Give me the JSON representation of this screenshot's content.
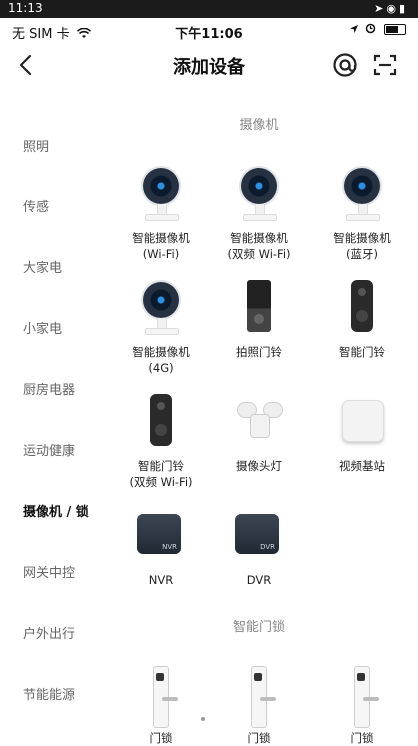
{
  "system_bar": {
    "time": "11:13"
  },
  "ios_status": {
    "carrier": "无 SIM 卡",
    "time": "下午11:06"
  },
  "navbar": {
    "title": "添加设备"
  },
  "sidebar": {
    "items": [
      {
        "label": "照明"
      },
      {
        "label": "传感"
      },
      {
        "label": "大家电"
      },
      {
        "label": "小家电"
      },
      {
        "label": "厨房电器"
      },
      {
        "label": "运动健康"
      },
      {
        "label": "摄像机 / 锁"
      },
      {
        "label": "网关中控"
      },
      {
        "label": "户外出行"
      },
      {
        "label": "节能能源"
      }
    ],
    "active": "摄像机 / 锁"
  },
  "sections": {
    "camera": {
      "title": "摄像机",
      "items": [
        {
          "line1": "智能摄像机",
          "line2": "(Wi-Fi)"
        },
        {
          "line1": "智能摄像机",
          "line2": "(双频 Wi-Fi)"
        },
        {
          "line1": "智能摄像机",
          "line2": "(蓝牙)"
        },
        {
          "line1": "智能摄像机",
          "line2": "(4G)"
        },
        {
          "line1": "拍照门铃",
          "line2": ""
        },
        {
          "line1": "智能门铃",
          "line2": ""
        },
        {
          "line1": "智能门铃",
          "line2": "(双频 Wi-Fi)"
        },
        {
          "line1": "摄像头灯",
          "line2": ""
        },
        {
          "line1": "视频基站",
          "line2": ""
        },
        {
          "line1": "NVR",
          "line2": ""
        },
        {
          "line1": "DVR",
          "line2": ""
        }
      ]
    },
    "lock": {
      "title": "智能门锁",
      "items": [
        {
          "line1": "门锁"
        },
        {
          "line1": "门锁"
        },
        {
          "line1": "门锁"
        }
      ]
    }
  },
  "device_badges": {
    "nvr": "NVR",
    "dvr": "DVR"
  },
  "colors": {
    "accent": "#2f8fe0",
    "text": "#222222",
    "muted": "#888888"
  }
}
